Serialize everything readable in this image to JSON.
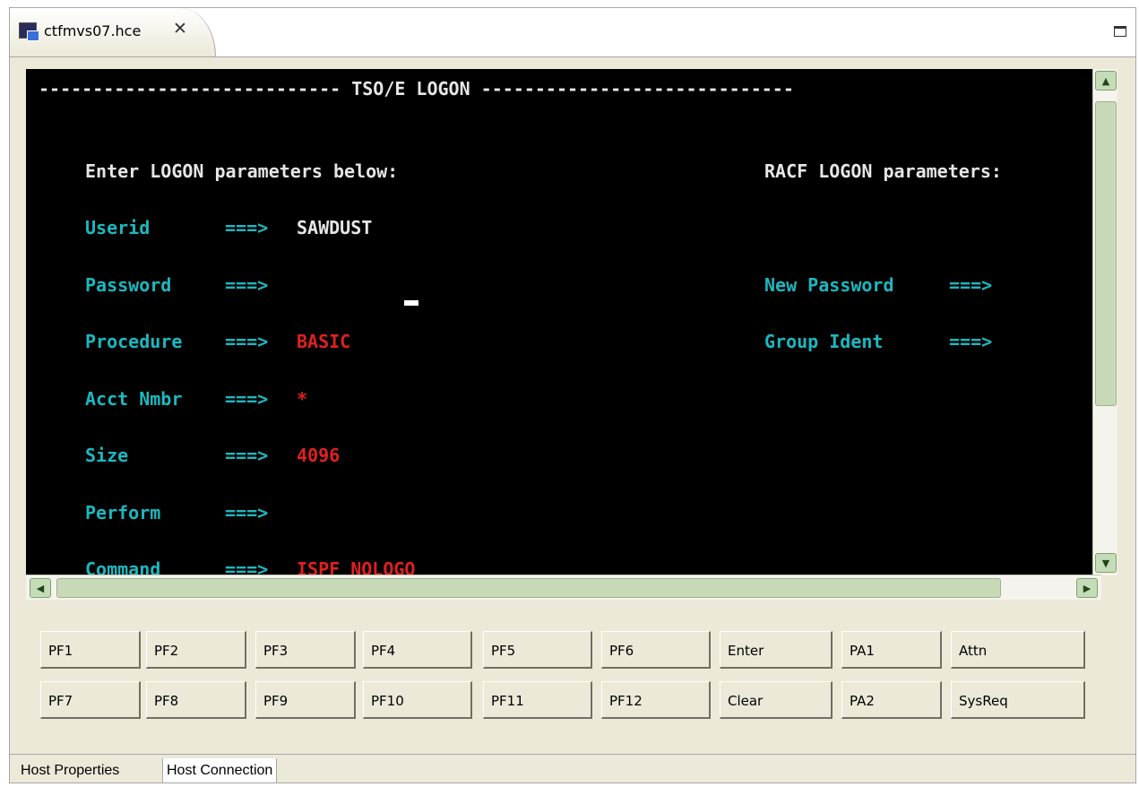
{
  "editor": {
    "tab_title": "ctfmvs07.hce",
    "tab_close": "✕"
  },
  "terminal": {
    "header": "---------------------------- TSO/E LOGON -----------------------------",
    "intro": "Enter LOGON parameters below:",
    "racf_title": "RACF LOGON parameters:",
    "fields": [
      {
        "label": "Userid",
        "arrow": "===>",
        "value": "SAWDUST"
      },
      {
        "label": "Password",
        "arrow": "===>",
        "value": ""
      },
      {
        "label": "Procedure",
        "arrow": "===>",
        "value": "BASIC"
      },
      {
        "label": "Acct Nmbr",
        "arrow": "===>",
        "value": "*"
      },
      {
        "label": "Size",
        "arrow": "===>",
        "value": "4096"
      },
      {
        "label": "Perform",
        "arrow": "===>",
        "value": ""
      },
      {
        "label": "Command",
        "arrow": "===>",
        "value": "ISPF NOLOGO"
      }
    ],
    "racf_fields": [
      {
        "label": "New Password",
        "arrow": "===>"
      },
      {
        "label": "Group Ident",
        "arrow": "===>"
      }
    ]
  },
  "keypad": {
    "row1": [
      "PF1",
      "PF2",
      "PF3",
      "PF4",
      "PF5",
      "PF6",
      "Enter",
      "PA1",
      "Attn"
    ],
    "row2": [
      "PF7",
      "PF8",
      "PF9",
      "PF10",
      "PF11",
      "PF12",
      "Clear",
      "PA2",
      "SysReq"
    ]
  },
  "bottom_tabs": {
    "host_properties": "Host Properties",
    "host_connection": "Host Connection",
    "active": "Host Connection"
  },
  "scroll": {
    "up": "▲",
    "down": "▼",
    "left": "◀",
    "right": "▶"
  }
}
